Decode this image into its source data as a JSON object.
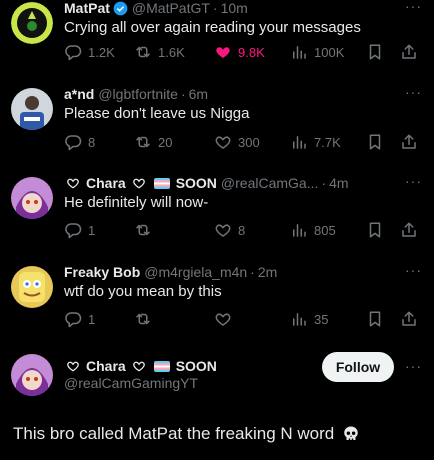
{
  "tweets": [
    {
      "name": "MatPat",
      "handle": "@MatPatGT",
      "time": "10m",
      "text": "Crying all over again reading your messages",
      "stats": {
        "replies": "1.2K",
        "retweets": "1.6K",
        "likes": "9.8K",
        "views": "100K"
      },
      "liked": true,
      "verified": true
    },
    {
      "name": "a*nd",
      "handle": "@lgbtfortnite",
      "time": "6m",
      "text": "Please don't leave us Nigga",
      "stats": {
        "replies": "8",
        "retweets": "20",
        "likes": "300",
        "views": "7.7K"
      }
    },
    {
      "name": "Chara",
      "name_suffix": "SOON",
      "handle": "@realCamGa...",
      "time": "4m",
      "text": "He definitely will now-",
      "stats": {
        "replies": "1",
        "retweets": "",
        "likes": "8",
        "views": "805"
      }
    },
    {
      "name": "Freaky Bob",
      "handle": "@m4rgiela_m4n",
      "time": "2m",
      "text": "wtf do you mean by this",
      "stats": {
        "replies": "1",
        "retweets": "",
        "likes": "",
        "views": "35"
      }
    }
  ],
  "profile_card": {
    "name": "Chara",
    "name_suffix": "SOON",
    "handle": "@realCamGamingYT",
    "follow_label": "Follow"
  },
  "caption": "This bro called MatPat the freaking N word",
  "colors": {
    "background": "#000000",
    "text": "#e7e9ea",
    "muted": "#71767b",
    "like": "#f91880",
    "verified": "#1d9bf0"
  },
  "icons": [
    "reply-icon",
    "retweet-icon",
    "like-icon",
    "views-icon",
    "bookmark-icon",
    "share-icon",
    "more-icon",
    "verified-icon",
    "heart-emoji-icon",
    "trans-flag-icon",
    "skull-icon"
  ]
}
